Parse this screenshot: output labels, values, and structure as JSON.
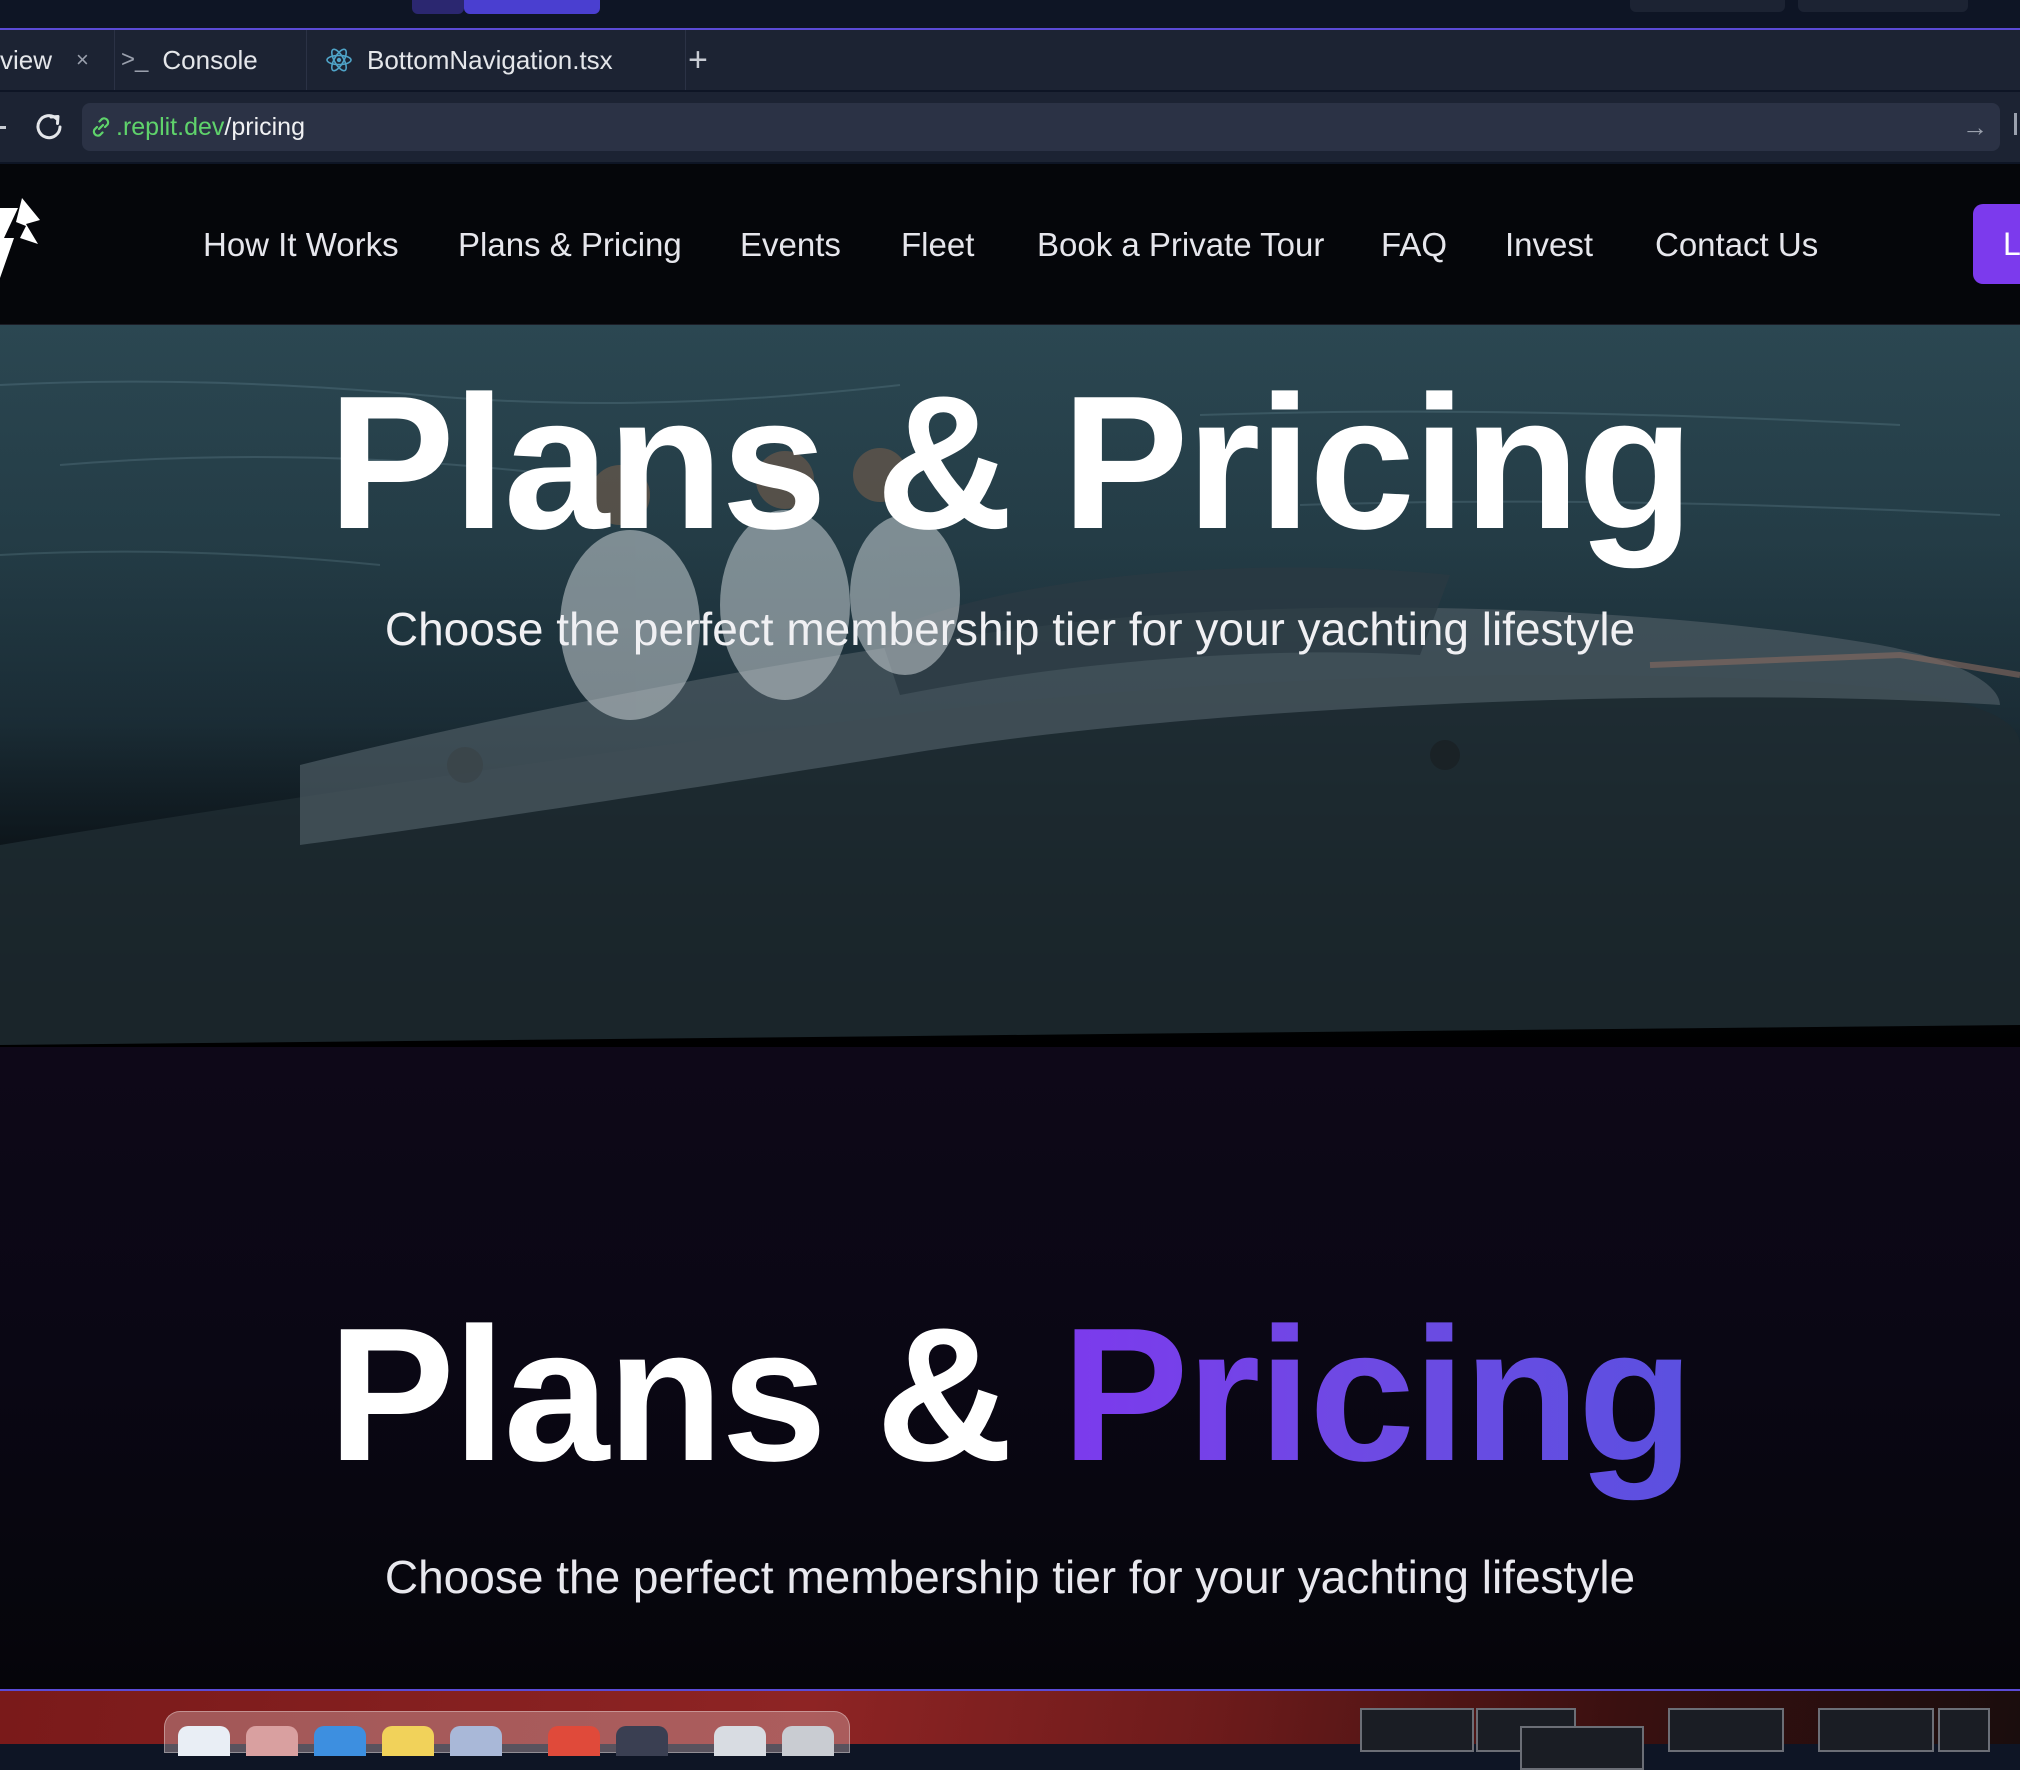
{
  "browser": {
    "tabs": [
      {
        "label": "view",
        "active": true
      },
      {
        "label": "Console"
      },
      {
        "label": "BottomNavigation.tsx"
      }
    ],
    "tab_close_glyph": "×",
    "tab_add_glyph": "+",
    "url": {
      "host": ".replit.dev",
      "path": "/pricing"
    },
    "go_glyph": "→",
    "console_glyph": ">_"
  },
  "site_nav": {
    "links": [
      "How It Works",
      "Plans & Pricing",
      "Events",
      "Fleet",
      "Book a Private Tour",
      "FAQ",
      "Invest",
      "Contact Us"
    ],
    "cta_label": "L"
  },
  "hero": {
    "title": "Plans & Pricing",
    "subtitle": "Choose the perfect membership tier for your yachting lifestyle"
  },
  "section": {
    "title_part1": "Plans & ",
    "title_accent": "Pricing",
    "subtitle": "Choose the perfect membership tier for your yachting lifestyle"
  },
  "colors": {
    "accent": "#7c3aed",
    "accent_end": "#5b50e0",
    "url_host": "#5fd36b",
    "ide_bg": "#1c2333",
    "border_accent": "#5b4bd6"
  },
  "icons": [
    "close-icon",
    "terminal-icon",
    "react-icon",
    "plus-icon",
    "reload-icon",
    "link-icon",
    "arrow-right-icon",
    "logo-mark"
  ]
}
